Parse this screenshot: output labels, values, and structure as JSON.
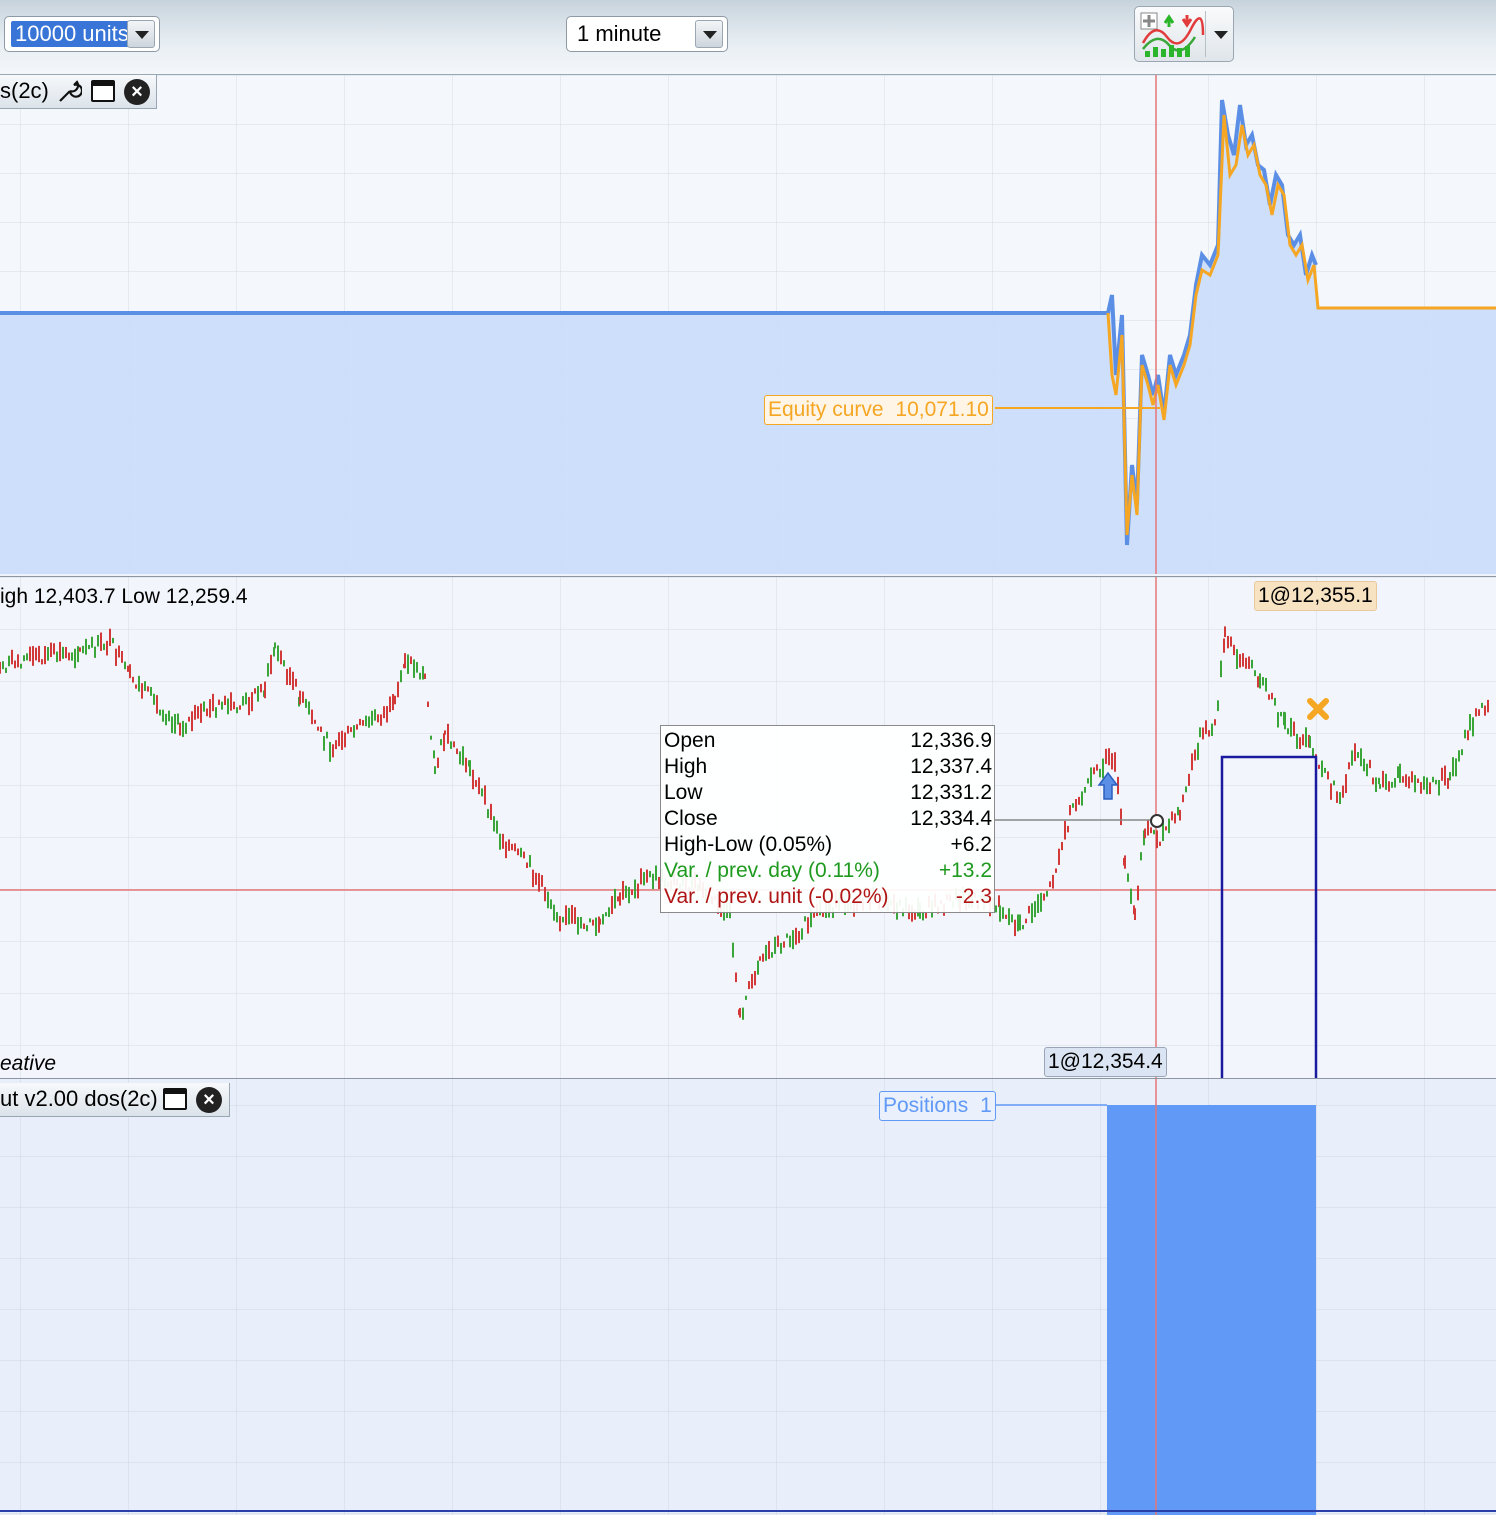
{
  "toolbar": {
    "units_select": {
      "value": "10000 units"
    },
    "timeframe_select": {
      "value": "1 minute"
    },
    "indicator_button": {
      "icon": "add-indicator-chart-icon"
    }
  },
  "panels": {
    "equity": {
      "tab_label": "s(2c)",
      "label_name": "Equity curve",
      "label_value": "10,071.10",
      "colors": {
        "equity_line": "#f5a623",
        "fill": "#c9dcf9",
        "series": "#5b8fe6"
      }
    },
    "price": {
      "header": "igh 12,403.7 Low 12,259.4",
      "footer": "eative",
      "order_top": "1@12,355.1",
      "order_bottom": "1@12,354.4",
      "tooltip": {
        "rows": [
          {
            "key": "Open",
            "value": "12,336.9",
            "color": "#000000"
          },
          {
            "key": "High",
            "value": "12,337.4",
            "color": "#000000"
          },
          {
            "key": "Low",
            "value": "12,331.2",
            "color": "#000000"
          },
          {
            "key": "Close",
            "value": "12,334.4",
            "color": "#000000"
          },
          {
            "key": "High-Low (0.05%)",
            "value": "+6.2",
            "color": "#000000"
          },
          {
            "key": "Var. / prev. day (0.11%)",
            "value": "+13.2",
            "color": "#1e9a1e"
          },
          {
            "key": "Var. / prev. unit (-0.02%)",
            "value": "-2.3",
            "color": "#b01515"
          }
        ]
      }
    },
    "positions": {
      "tab_label": "ut v2.00 dos(2c)",
      "label_name": "Positions",
      "label_value": "1",
      "colors": {
        "bar": "#6199f7"
      }
    }
  }
}
